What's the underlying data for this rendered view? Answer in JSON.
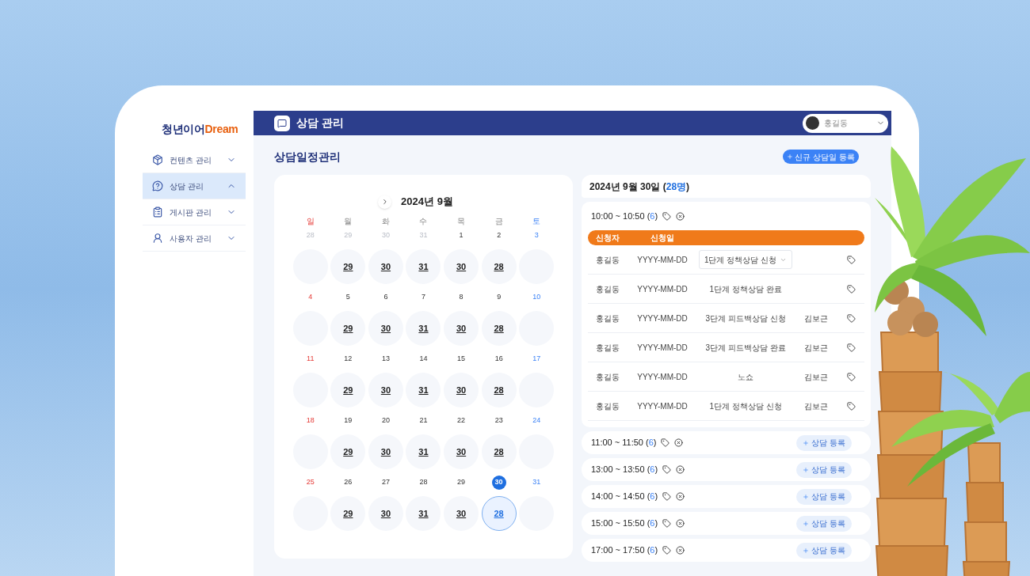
{
  "logo": {
    "part1": "청년이어",
    "part2": "Dream"
  },
  "sidebar": {
    "items": [
      {
        "label": "컨텐츠 관리",
        "selected": false,
        "expanded": false,
        "kind": "contents"
      },
      {
        "label": "상담 관리",
        "selected": true,
        "expanded": true,
        "kind": "consult"
      },
      {
        "label": "게시판 관리",
        "selected": false,
        "expanded": false,
        "kind": "board"
      },
      {
        "label": "사용자 관리",
        "selected": false,
        "expanded": false,
        "kind": "user"
      }
    ]
  },
  "header": {
    "title": "상담 관리",
    "user": "홍길동"
  },
  "page_title": "상담일정관리",
  "new_button": "신규 상담일 등록",
  "calendar": {
    "month": "2024년 9월",
    "weekdays": [
      "일",
      "월",
      "화",
      "수",
      "목",
      "금",
      "토"
    ],
    "weeks": [
      [
        {
          "date": "28",
          "muted": true,
          "selected": false
        },
        {
          "date": "29",
          "muted": true,
          "selected": false,
          "count": "29"
        },
        {
          "date": "30",
          "muted": true,
          "selected": false,
          "count": "30"
        },
        {
          "date": "31",
          "muted": true,
          "selected": false,
          "count": "31"
        },
        {
          "date": "1",
          "muted": false,
          "selected": false,
          "count": "30"
        },
        {
          "date": "2",
          "muted": false,
          "selected": false,
          "count": "28"
        },
        {
          "date": "3",
          "muted": false,
          "selected": false
        }
      ],
      [
        {
          "date": "4",
          "muted": false,
          "selected": false
        },
        {
          "date": "5",
          "muted": false,
          "selected": false,
          "count": "29"
        },
        {
          "date": "6",
          "muted": false,
          "selected": false,
          "count": "30"
        },
        {
          "date": "7",
          "muted": false,
          "selected": false,
          "count": "31"
        },
        {
          "date": "8",
          "muted": false,
          "selected": false,
          "count": "30"
        },
        {
          "date": "9",
          "muted": false,
          "selected": false,
          "count": "28"
        },
        {
          "date": "10",
          "muted": false,
          "selected": false
        }
      ],
      [
        {
          "date": "11",
          "muted": false,
          "selected": false
        },
        {
          "date": "12",
          "muted": false,
          "selected": false,
          "count": "29"
        },
        {
          "date": "13",
          "muted": false,
          "selected": false,
          "count": "30"
        },
        {
          "date": "14",
          "muted": false,
          "selected": false,
          "count": "31"
        },
        {
          "date": "15",
          "muted": false,
          "selected": false,
          "count": "30"
        },
        {
          "date": "16",
          "muted": false,
          "selected": false,
          "count": "28"
        },
        {
          "date": "17",
          "muted": false,
          "selected": false
        }
      ],
      [
        {
          "date": "18",
          "muted": false,
          "selected": false
        },
        {
          "date": "19",
          "muted": false,
          "selected": false,
          "count": "29"
        },
        {
          "date": "20",
          "muted": false,
          "selected": false,
          "count": "30"
        },
        {
          "date": "21",
          "muted": false,
          "selected": false,
          "count": "31"
        },
        {
          "date": "22",
          "muted": false,
          "selected": false,
          "count": "30"
        },
        {
          "date": "23",
          "muted": false,
          "selected": false,
          "count": "28"
        },
        {
          "date": "24",
          "muted": false,
          "selected": false
        }
      ],
      [
        {
          "date": "25",
          "muted": false,
          "selected": false
        },
        {
          "date": "26",
          "muted": false,
          "selected": false,
          "count": "29"
        },
        {
          "date": "27",
          "muted": false,
          "selected": false,
          "count": "30"
        },
        {
          "date": "28",
          "muted": false,
          "selected": false,
          "count": "31"
        },
        {
          "date": "29",
          "muted": false,
          "selected": false,
          "count": "30"
        },
        {
          "date": "30",
          "muted": false,
          "selected": true,
          "count": "28"
        },
        {
          "date": "31",
          "muted": false,
          "selected": false
        }
      ]
    ]
  },
  "schedule": {
    "heading_prefix": "2024년 9월 30일 (",
    "heading_count": "28명",
    "heading_suffix": ")",
    "slots": [
      {
        "label_before": "10:00 ~ 10:50 (",
        "count": "6",
        "label_after": ")",
        "expanded": true,
        "columns": [
          "신청자",
          "신청일"
        ],
        "rows": [
          {
            "applicant": "홍길동",
            "date": "YYYY-MM-DD",
            "status": "1단계 정책상담 신청",
            "kind": "dropdown"
          },
          {
            "applicant": "홍길동",
            "date": "YYYY-MM-DD",
            "status": "1단계 정책상담 완료",
            "kind": "text"
          },
          {
            "applicant": "홍길동",
            "date": "YYYY-MM-DD",
            "status": "3단계 피드백상담 신청",
            "kind": "text",
            "staff": "김보근"
          },
          {
            "applicant": "홍길동",
            "date": "YYYY-MM-DD",
            "status": "3단계 피드백상담 완료",
            "kind": "text",
            "staff": "김보근"
          },
          {
            "applicant": "홍길동",
            "date": "YYYY-MM-DD",
            "status": "노쇼",
            "kind": "text",
            "staff": "김보근"
          },
          {
            "applicant": "홍길동",
            "date": "YYYY-MM-DD",
            "status": "1단계 정책상담 신청",
            "kind": "text",
            "staff": "김보근"
          }
        ]
      },
      {
        "label_before": "11:00 ~ 11:50 (",
        "count": "6",
        "label_after": ")",
        "expanded": false,
        "button": "상담 등록"
      },
      {
        "label_before": "13:00 ~ 13:50 (",
        "count": "6",
        "label_after": ")",
        "expanded": false,
        "button": "상담 등록"
      },
      {
        "label_before": "14:00 ~ 14:50 (",
        "count": "6",
        "label_after": ")",
        "expanded": false,
        "button": "상담 등록"
      },
      {
        "label_before": "15:00 ~ 15:50 (",
        "count": "6",
        "label_after": ")",
        "expanded": false,
        "button": "상담 등록"
      },
      {
        "label_before": "17:00 ~ 17:50 (",
        "count": "6",
        "label_after": ")",
        "expanded": false,
        "button": "상담 등록"
      }
    ]
  }
}
